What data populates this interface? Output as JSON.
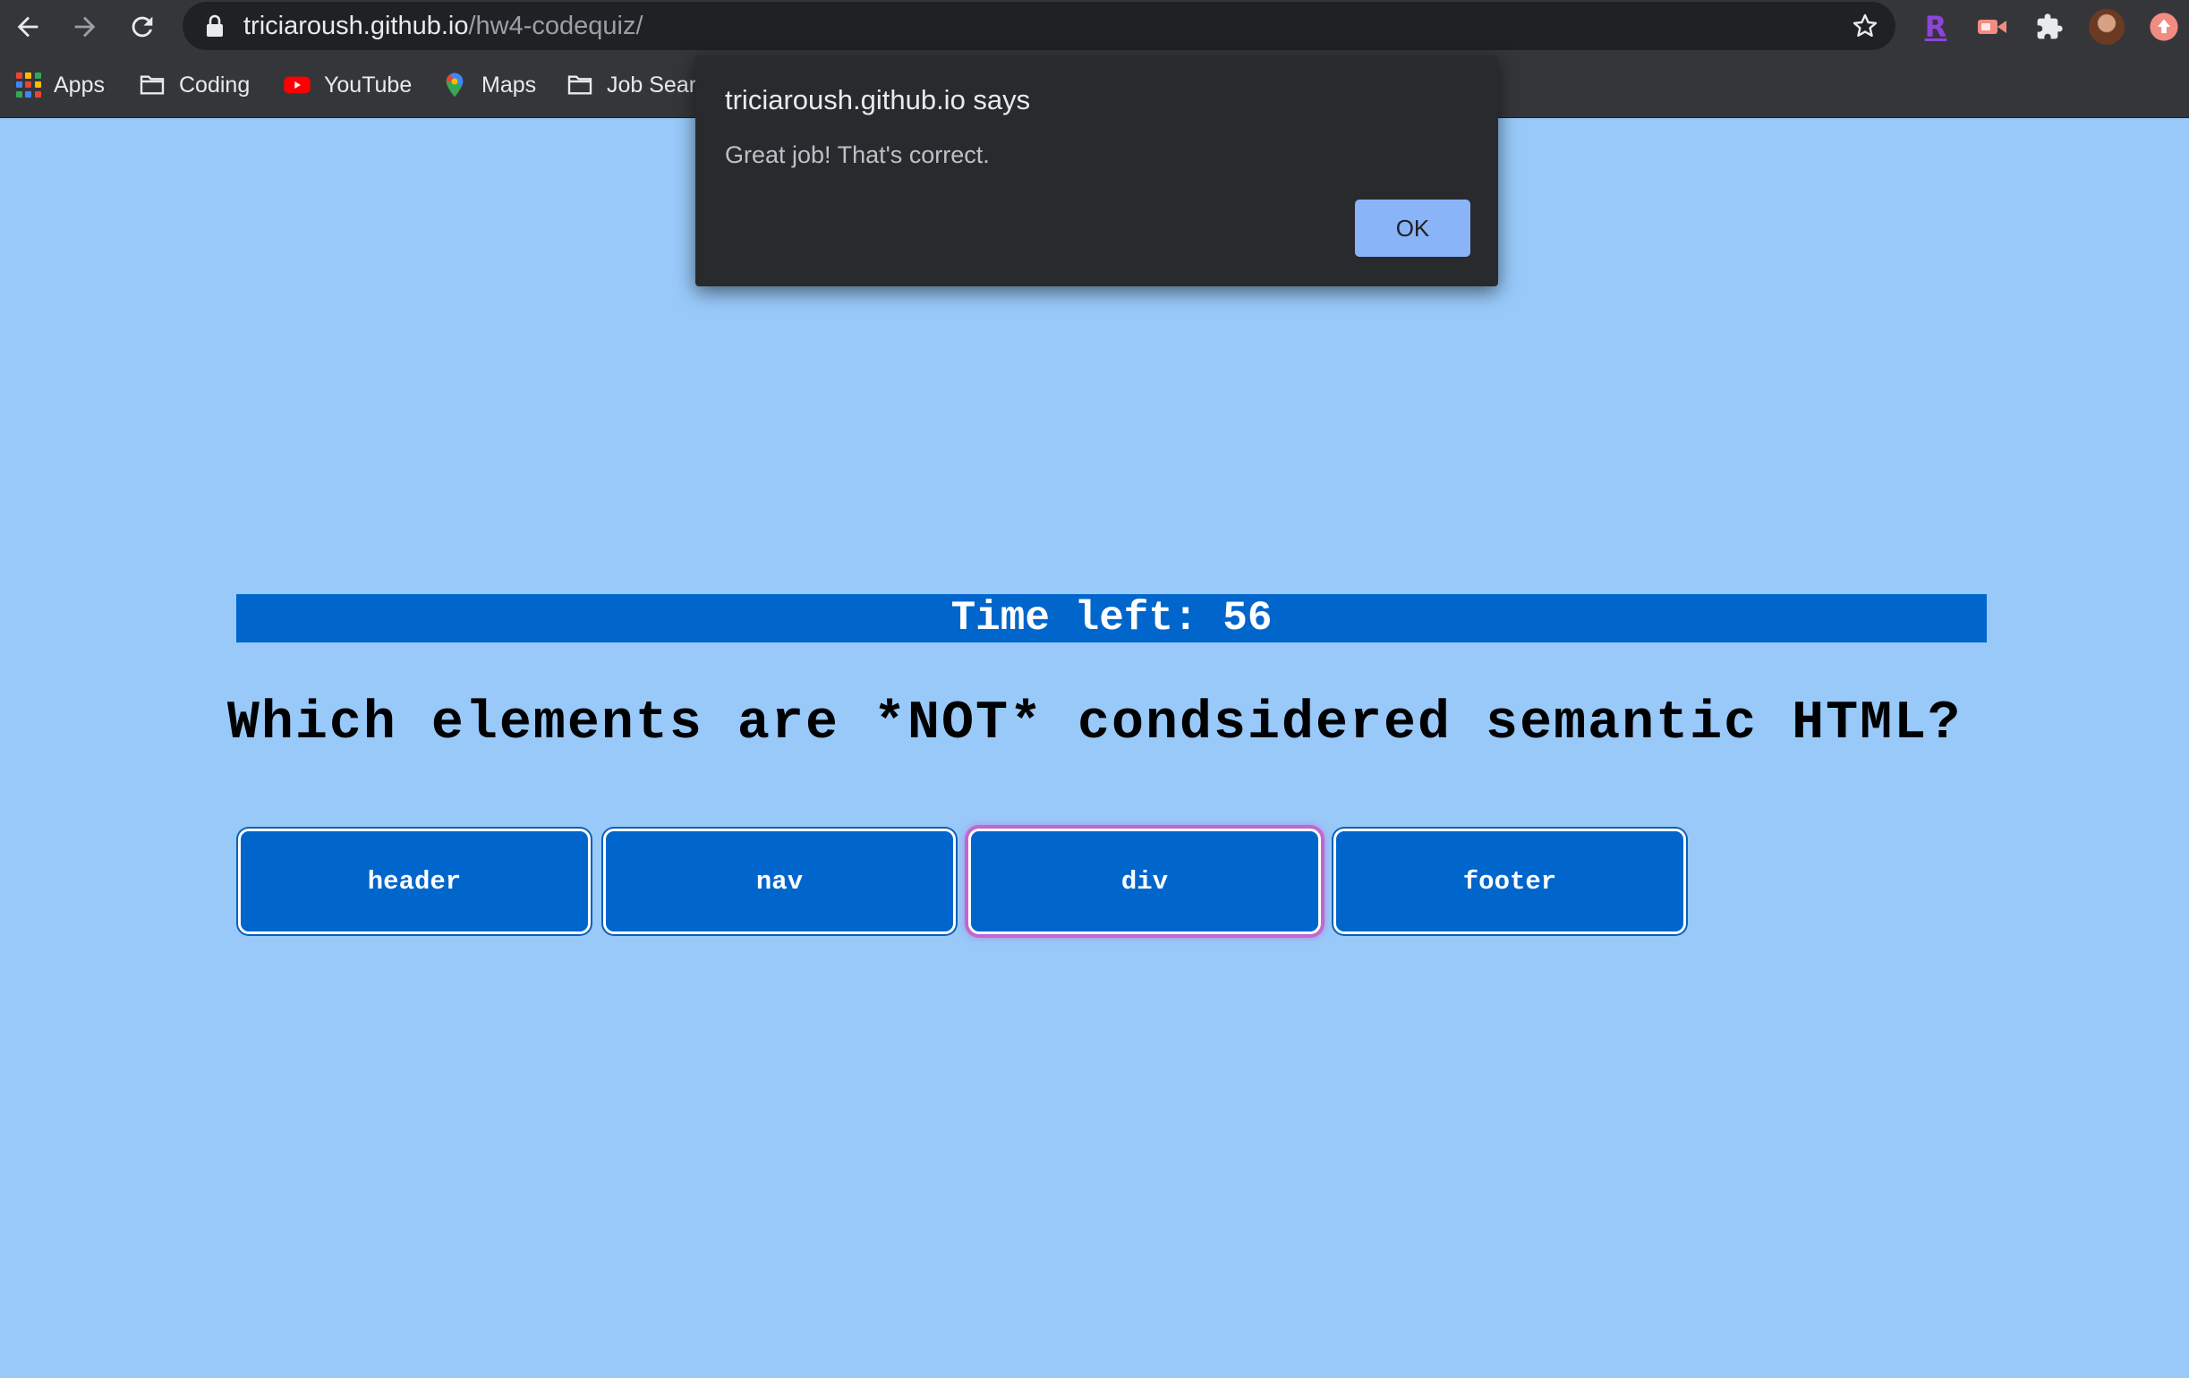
{
  "browser": {
    "url_host": "triciaroush.github.io",
    "url_path": "/hw4-codequiz/",
    "bookmarks": [
      {
        "label": "Apps",
        "icon": "apps-grid-icon"
      },
      {
        "label": "Coding",
        "icon": "folder-icon"
      },
      {
        "label": "YouTube",
        "icon": "youtube-icon"
      },
      {
        "label": "Maps",
        "icon": "maps-pin-icon"
      },
      {
        "label": "Job Sear",
        "icon": "folder-icon"
      }
    ],
    "extensions": [
      {
        "label": "R",
        "icon": "r-extension-icon"
      }
    ]
  },
  "quiz": {
    "timer_text": "Time left: 56",
    "question": "Which elements are *NOT* condsidered semantic HTML?",
    "answers": [
      "header",
      "nav",
      "div",
      "footer"
    ],
    "focused_answer": "div",
    "accent": "#0066cc",
    "page_background": "#98c9f9"
  },
  "dialog": {
    "title": "triciaroush.github.io says",
    "message": "Great job! That's correct.",
    "ok_label": "OK"
  }
}
